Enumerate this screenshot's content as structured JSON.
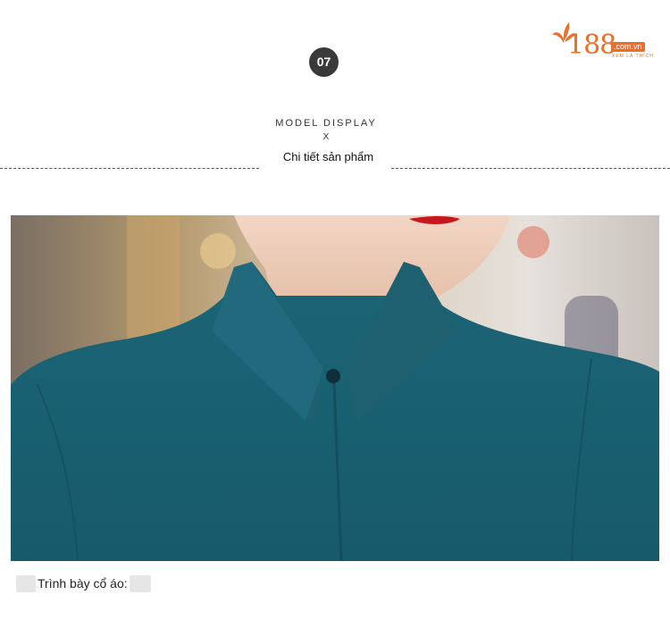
{
  "logo": {
    "number": "188",
    "domain": ".com.vn",
    "tagline": "XEM LÀ THÍCH",
    "color": "#e8702a"
  },
  "step": {
    "number": "07"
  },
  "heading": {
    "title": "MODEL DISPLAY",
    "separator": "X",
    "subtitle": "Chi tiết sản phẩm"
  },
  "photo": {
    "subject": "model-teal-blouse-collar-closeup",
    "blouse_color": "#1f6b7d"
  },
  "caption": {
    "text": "Trình bày cổ áo:"
  }
}
